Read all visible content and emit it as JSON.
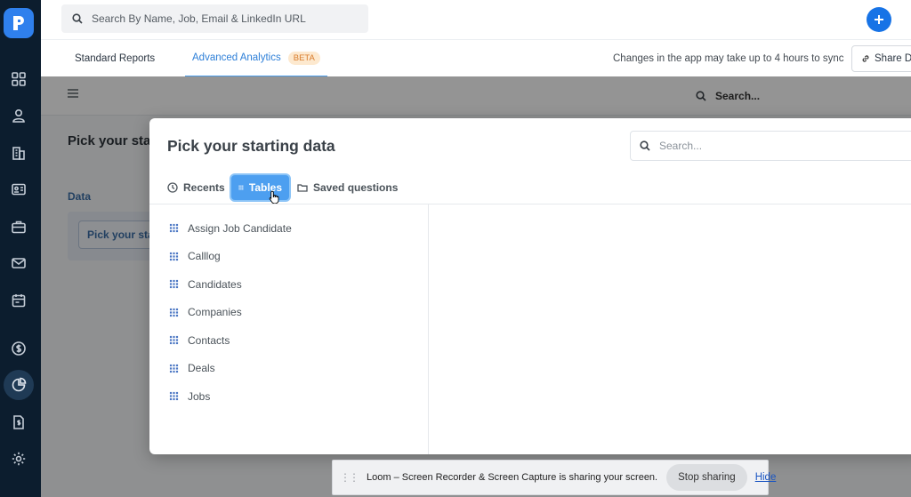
{
  "sidebar": {
    "items": [
      {
        "icon": "grid-icon"
      },
      {
        "icon": "contact-icon"
      },
      {
        "icon": "building-icon"
      },
      {
        "icon": "id-card-icon"
      },
      {
        "icon": "briefcase-icon"
      },
      {
        "icon": "mail-icon"
      },
      {
        "icon": "calendar-icon"
      },
      {
        "icon": "dollar-icon"
      },
      {
        "icon": "pie-chart-icon",
        "active": true
      },
      {
        "icon": "invoice-icon"
      },
      {
        "icon": "gear-icon"
      }
    ]
  },
  "topbar": {
    "search_placeholder": "Search By Name, Job, Email & LinkedIn URL",
    "add_icon": "plus-icon"
  },
  "tabs": {
    "standard": "Standard Reports",
    "advanced": "Advanced Analytics",
    "beta": "BETA",
    "sync_note": "Changes in the app may take up to 4 hours to sync",
    "share": "Share Da"
  },
  "background": {
    "search": "Search...",
    "title": "Pick your sta",
    "data_label": "Data",
    "pick_button": "Pick your sta"
  },
  "modal": {
    "title": "Pick your starting data",
    "search_placeholder": "Search...",
    "tabs": {
      "recents": "Recents",
      "tables": "Tables",
      "saved": "Saved questions"
    },
    "tables": [
      "Assign Job Candidate",
      "Calllog",
      "Candidates",
      "Companies",
      "Contacts",
      "Deals",
      "Jobs"
    ]
  },
  "loom": {
    "message": "Loom – Screen Recorder & Screen Capture is sharing your screen.",
    "stop": "Stop sharing",
    "hide": "Hide"
  },
  "colors": {
    "sidebar": "#0c1d2e",
    "accent": "#1773e6",
    "tab_active": "#2d7fd8",
    "tables_tab": "#4d9ff0"
  }
}
